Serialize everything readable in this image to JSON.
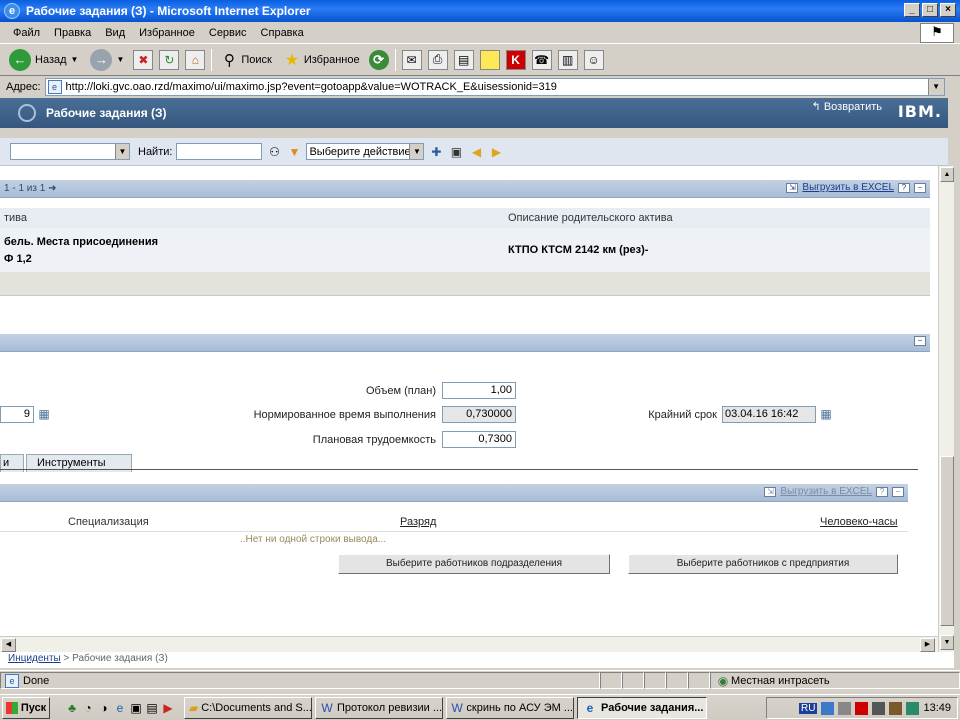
{
  "window": {
    "title": "Рабочие задания (З) - Microsoft Internet Explorer"
  },
  "menu": [
    "Файл",
    "Правка",
    "Вид",
    "Избранное",
    "Сервис",
    "Справка"
  ],
  "toolbar": {
    "back": "Назад",
    "search": "Поиск",
    "favorites": "Избранное"
  },
  "address": {
    "label": "Адрес:",
    "url": "http://loki.gvc.oao.rzd/maximo/ui/maximo.jsp?event=gotoapp&value=WOTRACK_E&uisessionid=319"
  },
  "app": {
    "title": "Рабочие задания (З)",
    "return_label": "Возвратить",
    "brand": "IBM."
  },
  "apptoolbar": {
    "find_label": "Найти:",
    "find_value": "",
    "action_placeholder": "Выберите действие"
  },
  "section1": {
    "counter": "1 - 1 из 1",
    "export_label": "Выгрузить в EXCEL",
    "col_left": "тива",
    "col_right": "Описание родительского актива",
    "row_left_line1": "бель. Места присоединения",
    "row_left_line2": "Ф 1,2",
    "row_right": "КТПО КТСМ 2142 км (рез)-"
  },
  "plan": {
    "left_value": "9",
    "volume_label": "Объем (план)",
    "volume_value": "1,00",
    "norm_time_label": "Нормированное время выполнения",
    "norm_time_value": "0,730000",
    "labor_label": "Плановая трудоемкость",
    "labor_value": "0,7300",
    "deadline_label": "Крайний срок",
    "deadline_value": "03.04.16 16:42"
  },
  "tabs": {
    "partial": "и",
    "tools": "Инструменты"
  },
  "section2": {
    "export_label": "Выгрузить в EXCEL",
    "col_spec": "Специализация",
    "col_grade": "Разряд",
    "col_hours": "Человеко-часы",
    "empty_text": "..Нет ни одной строки вывода...",
    "btn_dept": "Выберите работников подразделения",
    "btn_enterprise": "Выберите работников с предприятия"
  },
  "breadcrumb": {
    "link": "Инциденты",
    "separator": " > ",
    "current": "Рабочие задания (З)"
  },
  "status": {
    "left": "Done",
    "zone": "Местная интрасеть"
  },
  "taskbar": {
    "start": "Пуск",
    "tasks": [
      "C:\\Documents and S...",
      "Протокол ревизии ...",
      "скринь по АСУ ЭМ ...",
      "Рабочие задания..."
    ],
    "lang": "RU",
    "clock": "13:49"
  }
}
